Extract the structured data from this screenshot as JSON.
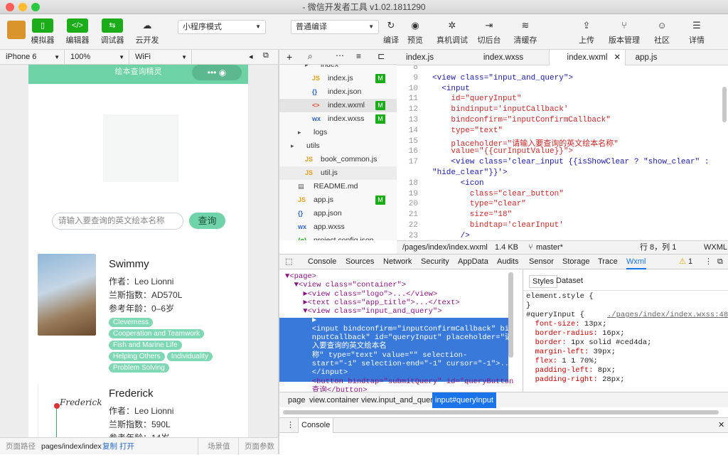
{
  "window": {
    "title": "- 微信开发者工具 v1.02.1811290"
  },
  "toolbar": {
    "simulator": "模拟器",
    "editor": "编辑器",
    "debugger": "调试器",
    "cloud": "云开发",
    "mode": "小程序模式",
    "compile_mode": "普通编译",
    "compile": "编译",
    "preview": "预览",
    "real_debug": "真机调试",
    "background": "切后台",
    "clear_cache": "清缓存",
    "upload": "上传",
    "version": "版本管理",
    "community": "社区",
    "details": "详情"
  },
  "simbar": {
    "device": "iPhone 6",
    "zoom": "100%",
    "network": "WiFi"
  },
  "app": {
    "nav_title": "绘本查询精灵",
    "capsule": "••• ◉",
    "search_placeholder": "请输入要查询的英文绘本名称",
    "search_button": "查询"
  },
  "books": [
    {
      "title": "Swimmy",
      "author": "作者：Leo Lionni",
      "lexile": "兰斯指数：AD570L",
      "age": "参考年龄：0–6岁",
      "tags": [
        "Cleverness",
        "Cooperation and Teamwork",
        "Fish and Marine Life",
        "Helping Others",
        "Individuality",
        "Problem Solving"
      ]
    },
    {
      "title": "Frederick",
      "author": "作者：Leo Lionni",
      "lexile": "兰斯指数：590L",
      "age": "参考年龄：14岁",
      "tags": []
    }
  ],
  "simfoot": {
    "path_label": "页面路径",
    "path": "pages/index/index",
    "copy": "复制",
    "open": "打开",
    "scene": "场景值",
    "params": "页面参数"
  },
  "files": [
    {
      "name": "index",
      "indent": 3,
      "type": "folder",
      "badge": ""
    },
    {
      "name": "index.js",
      "indent": 4,
      "type": "js",
      "badge": "M"
    },
    {
      "name": "index.json",
      "indent": 4,
      "type": "json",
      "badge": ""
    },
    {
      "name": "index.wxml",
      "indent": 4,
      "type": "wxml",
      "badge": "M"
    },
    {
      "name": "index.wxss",
      "indent": 4,
      "type": "wxss",
      "badge": "M"
    },
    {
      "name": "logs",
      "indent": 2,
      "type": "folder",
      "badge": ""
    },
    {
      "name": "utils",
      "indent": 1,
      "type": "folder",
      "badge": ""
    },
    {
      "name": "book_common.js",
      "indent": 3,
      "type": "js",
      "badge": ""
    },
    {
      "name": "util.js",
      "indent": 3,
      "type": "js",
      "badge": ""
    },
    {
      "name": "README.md",
      "indent": 2,
      "type": "md",
      "badge": ""
    },
    {
      "name": "app.js",
      "indent": 2,
      "type": "js",
      "badge": "M"
    },
    {
      "name": "app.json",
      "indent": 2,
      "type": "json",
      "badge": ""
    },
    {
      "name": "app.wxss",
      "indent": 2,
      "type": "wxss",
      "badge": ""
    },
    {
      "name": "project.config.json",
      "indent": 2,
      "type": "config",
      "badge": ""
    }
  ],
  "tabs": [
    "index.js",
    "index.wxss",
    "index.wxml",
    "app.js"
  ],
  "code": [
    {
      "n": "8",
      "t": ""
    },
    {
      "n": "9",
      "t": "<view class=\"input_and_query\">"
    },
    {
      "n": "10",
      "t": "  <input"
    },
    {
      "n": "11",
      "t": "    id=\"queryInput\""
    },
    {
      "n": "12",
      "t": "    bindinput='inputCallback'"
    },
    {
      "n": "13",
      "t": "    bindconfirm=\"inputConfirmCallback\""
    },
    {
      "n": "14",
      "t": "    type=\"text\""
    },
    {
      "n": "15",
      "t": "    placeholder=\"请输入要查询的英文绘本名称\""
    },
    {
      "n": "16",
      "t": "    value=\"{{curInputValue}}\">"
    },
    {
      "n": "17",
      "t": "    <view class='clear_input {{isShowClear ? \"show_clear\" :"
    },
    {
      "n": "",
      "t": "\"hide_clear\"}}'>"
    },
    {
      "n": "18",
      "t": "      <icon"
    },
    {
      "n": "19",
      "t": "        class=\"clear_button\""
    },
    {
      "n": "20",
      "t": "        type=\"clear\""
    },
    {
      "n": "21",
      "t": "        size=\"18\""
    },
    {
      "n": "22",
      "t": "        bindtap='clearInput'"
    },
    {
      "n": "23",
      "t": "      />"
    }
  ],
  "edstatus": {
    "path": "/pages/index/index.wxml",
    "size": "1.4 KB",
    "branch": "master*",
    "pos": "行 8，列 1",
    "lang": "WXML"
  },
  "devtools": {
    "tabs": [
      "Console",
      "Sources",
      "Network",
      "Security",
      "AppData",
      "Audits",
      "Sensor",
      "Storage",
      "Trace",
      "Wxml"
    ],
    "warn": "1"
  },
  "dom": [
    "▼<page>",
    "  ▼<view class=\"container\">",
    "    ►<view class=\"logo\">...</view>",
    "    ►<text class=\"app_title\">...</text>",
    "    ▼<view class=\"input_and_query\">",
    "      ►",
    "      <input bindconfirm=\"inputConfirmCallback\" bindi",
    "      nputCallback\" id=\"queryInput\" placeholder=\"请输",
    "      入要查询的英文绘本名",
    "      称\" type=\"text\" value=\"\" selection-",
    "      start=\"-1\" selection-end=\"-1\" cursor=\"-1\">...",
    "      </input>",
    "      <button bindtap=\"submitQuery\" id=\"queryButton",
    "      查询</button>"
  ],
  "styles_tabs": {
    "styles": "Styles",
    "dataset": "Dataset"
  },
  "styles": [
    {
      "k": "element.style {",
      "v": ""
    },
    {
      "k": "}",
      "v": ""
    },
    {
      "k": "#queryInput {",
      "v": "./pages/index/index.wxss:48"
    },
    {
      "k": "  font-size:",
      "v": " 13px;"
    },
    {
      "k": "  border-radius:",
      "v": " 16px;"
    },
    {
      "k": "  border:",
      "v": " 1px solid #ced4da;"
    },
    {
      "k": "  margin-left:",
      "v": " 39px;"
    },
    {
      "k": "  flex:",
      "v": " 1 1 70%;"
    },
    {
      "k": "  padding-left:",
      "v": " 8px;"
    },
    {
      "k": "  padding-right:",
      "v": " 28px;"
    }
  ],
  "crumbs": [
    "page",
    "view.container",
    "view.input_and_query",
    "input#queryInput"
  ],
  "console_label": "Console"
}
